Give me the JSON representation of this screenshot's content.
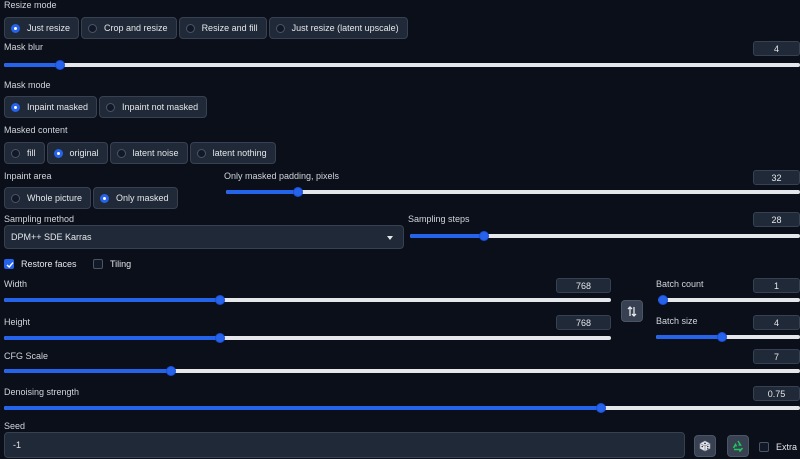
{
  "resize_mode": {
    "label": "Resize mode",
    "options": [
      "Just resize",
      "Crop and resize",
      "Resize and fill",
      "Just resize (latent upscale)"
    ],
    "selected": "Just resize"
  },
  "mask_blur": {
    "label": "Mask blur",
    "value": "4",
    "fraction": 0.07
  },
  "mask_mode": {
    "label": "Mask mode",
    "options": [
      "Inpaint masked",
      "Inpaint not masked"
    ],
    "selected": "Inpaint masked"
  },
  "masked_content": {
    "label": "Masked content",
    "options": [
      "fill",
      "original",
      "latent noise",
      "latent nothing"
    ],
    "selected": "original"
  },
  "inpaint_area": {
    "label": "Inpaint area",
    "options": [
      "Whole picture",
      "Only masked"
    ],
    "selected": "Only masked"
  },
  "only_masked_padding": {
    "label": "Only masked padding, pixels",
    "value": "32",
    "fraction": 0.125
  },
  "sampling_method": {
    "label": "Sampling method",
    "value": "DPM++ SDE Karras"
  },
  "sampling_steps": {
    "label": "Sampling steps",
    "value": "28",
    "fraction": 0.19
  },
  "restore_faces": {
    "label": "Restore faces",
    "checked": true
  },
  "tiling": {
    "label": "Tiling",
    "checked": false
  },
  "width": {
    "label": "Width",
    "value": "768",
    "fraction": 0.356
  },
  "height": {
    "label": "Height",
    "value": "768",
    "fraction": 0.356
  },
  "batch_count": {
    "label": "Batch count",
    "value": "1",
    "fraction": 0.0
  },
  "batch_size": {
    "label": "Batch size",
    "value": "4",
    "fraction": 0.46
  },
  "cfg_scale": {
    "label": "CFG Scale",
    "value": "7",
    "fraction": 0.21
  },
  "denoising_strength": {
    "label": "Denoising strength",
    "value": "0.75",
    "fraction": 0.75
  },
  "seed": {
    "label": "Seed",
    "value": "-1"
  },
  "extra": {
    "label": "Extra",
    "checked": false
  },
  "icons": {
    "swap": "swap-arrows-icon",
    "random": "dice-icon",
    "reuse": "recycle-icon"
  },
  "colors": {
    "accent": "#2563eb",
    "background": "#0b0f19",
    "panel": "#1f2937"
  }
}
